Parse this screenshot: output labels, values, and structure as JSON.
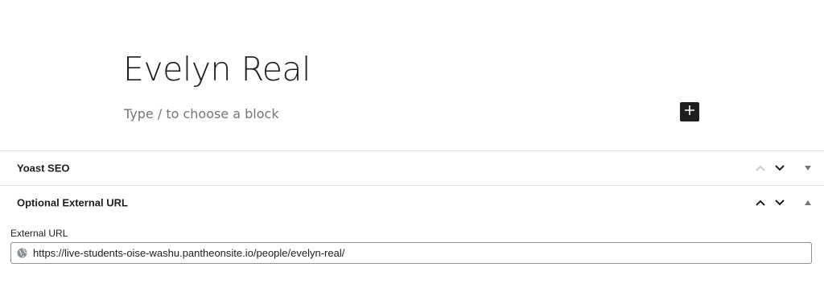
{
  "editor": {
    "post_title": "Evelyn Real",
    "block_placeholder": "Type / to choose a block",
    "inserter_icon": "plus-icon"
  },
  "panels": [
    {
      "title": "Yoast SEO",
      "expanded": false,
      "move_up_disabled": true
    },
    {
      "title": "Optional External URL",
      "expanded": true,
      "move_up_disabled": false
    }
  ],
  "external_url": {
    "label": "External URL",
    "value": "https://live-students-oise-washu.pantheonsite.io/people/evelyn-real/",
    "icon": "globe-icon"
  },
  "colors": {
    "inserter_bg": "#1e1e1e",
    "border": "#e0e0e0",
    "disabled_icon": "#c3c4c7"
  }
}
